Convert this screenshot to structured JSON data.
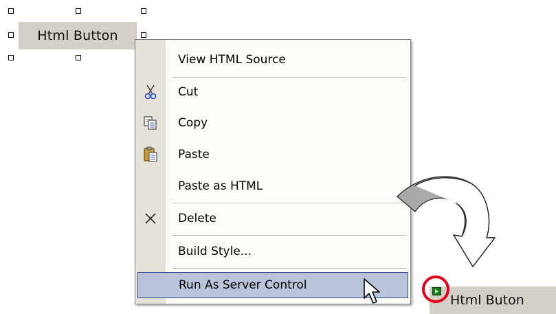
{
  "design_button": {
    "label": "Html Button"
  },
  "context_menu": {
    "items": [
      {
        "label": "View HTML Source",
        "icon": ""
      },
      {
        "label": "Cut",
        "icon": "scissors-icon"
      },
      {
        "label": "Copy",
        "icon": "copy-icon"
      },
      {
        "label": "Paste",
        "icon": "clipboard-icon"
      },
      {
        "label": "Paste as HTML",
        "icon": ""
      },
      {
        "label": "Delete",
        "icon": "delete-x-icon"
      },
      {
        "label": "Build Style...",
        "icon": ""
      },
      {
        "label": "Run As Server Control",
        "icon": "",
        "highlighted": true
      }
    ]
  },
  "server_button": {
    "label": "Html Buton"
  },
  "colors": {
    "menu_gutter": "#e5e3d9",
    "highlight_fill": "#b9c3da",
    "highlight_border": "#2d4a8f",
    "annotation_circle": "#e3001b",
    "button_face": "#d4d0c8"
  }
}
